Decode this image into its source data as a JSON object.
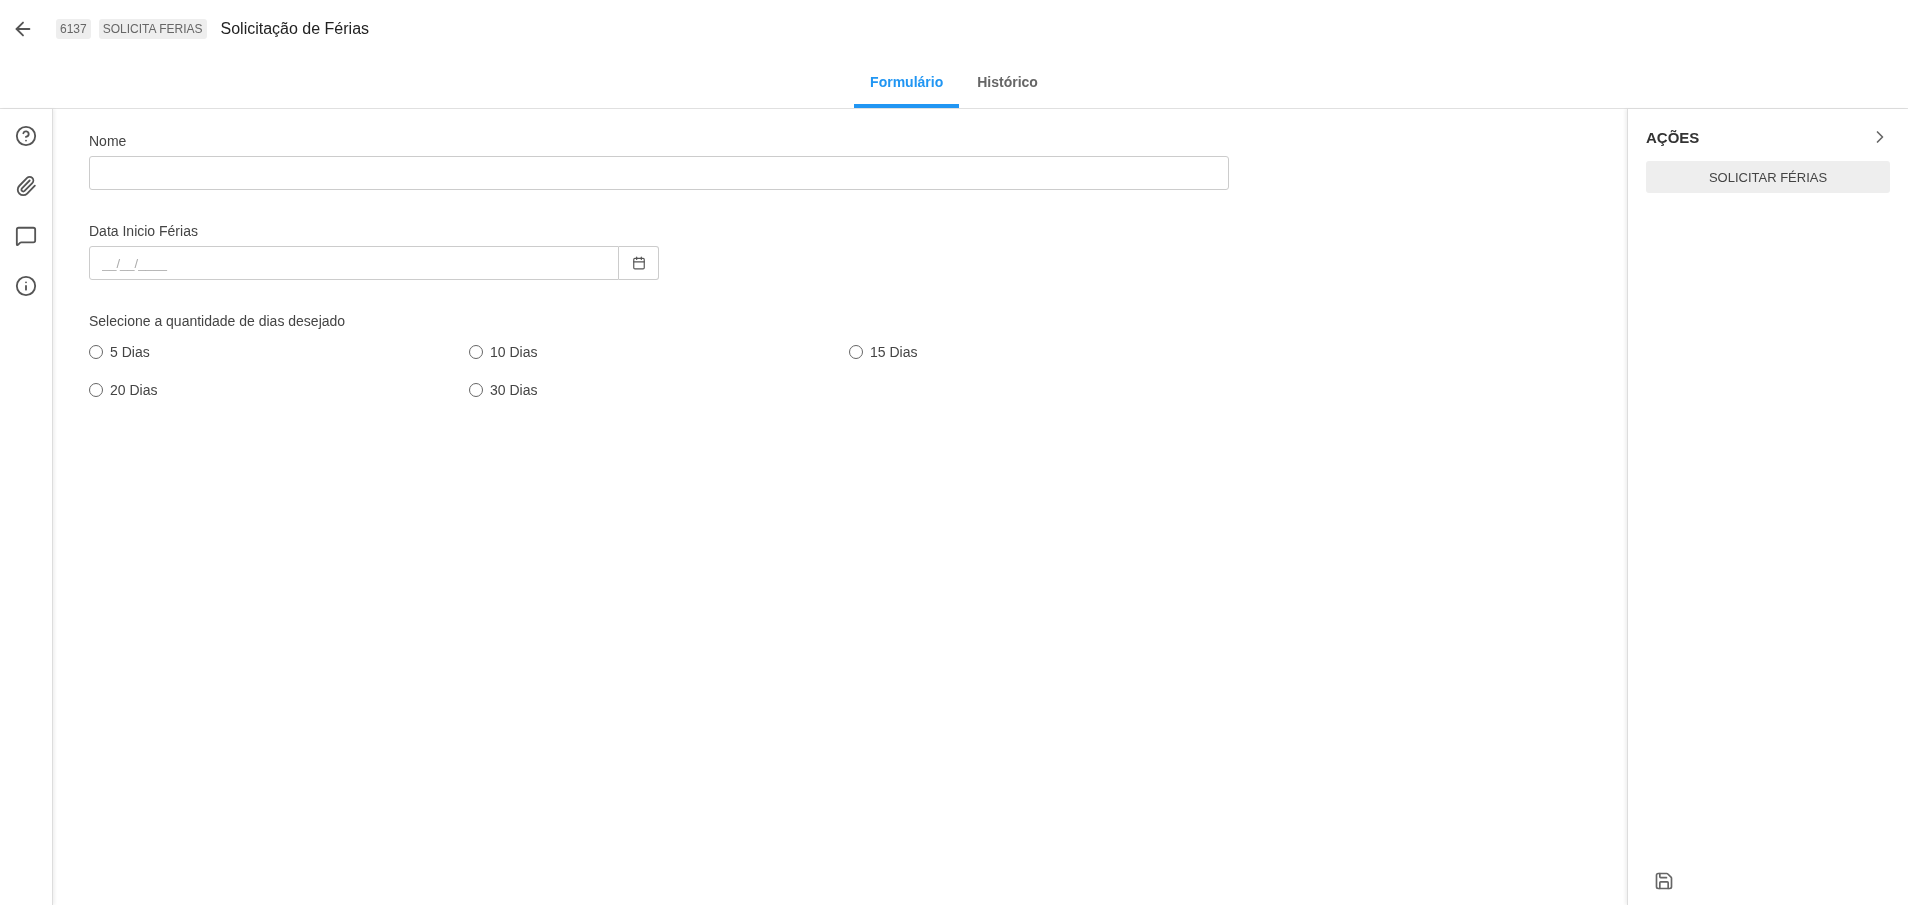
{
  "header": {
    "badges": [
      "6137",
      "SOLICITA FERIAS"
    ],
    "title": "Solicitação de Férias"
  },
  "tabs": [
    {
      "label": "Formulário",
      "selected": true
    },
    {
      "label": "Histórico",
      "selected": false
    }
  ],
  "form": {
    "fields": [
      {
        "kind": "text",
        "label": "Nome"
      },
      {
        "kind": "date",
        "label": "Data Inicio Férias",
        "placeholder": "__/__/____"
      }
    ],
    "radio_group": {
      "label": "Selecione a quantidade de dias desejado",
      "options": [
        {
          "label": "5 Dias",
          "selected": false
        },
        {
          "label": "10 Dias",
          "selected": false
        },
        {
          "label": "15 Dias",
          "selected": false
        },
        {
          "label": "20 Dias",
          "selected": false
        },
        {
          "label": "30 Dias",
          "selected": false
        }
      ]
    }
  },
  "actions_panel": {
    "title": "AÇÕES",
    "buttons": [
      "SOLICITAR FÉRIAS"
    ]
  }
}
